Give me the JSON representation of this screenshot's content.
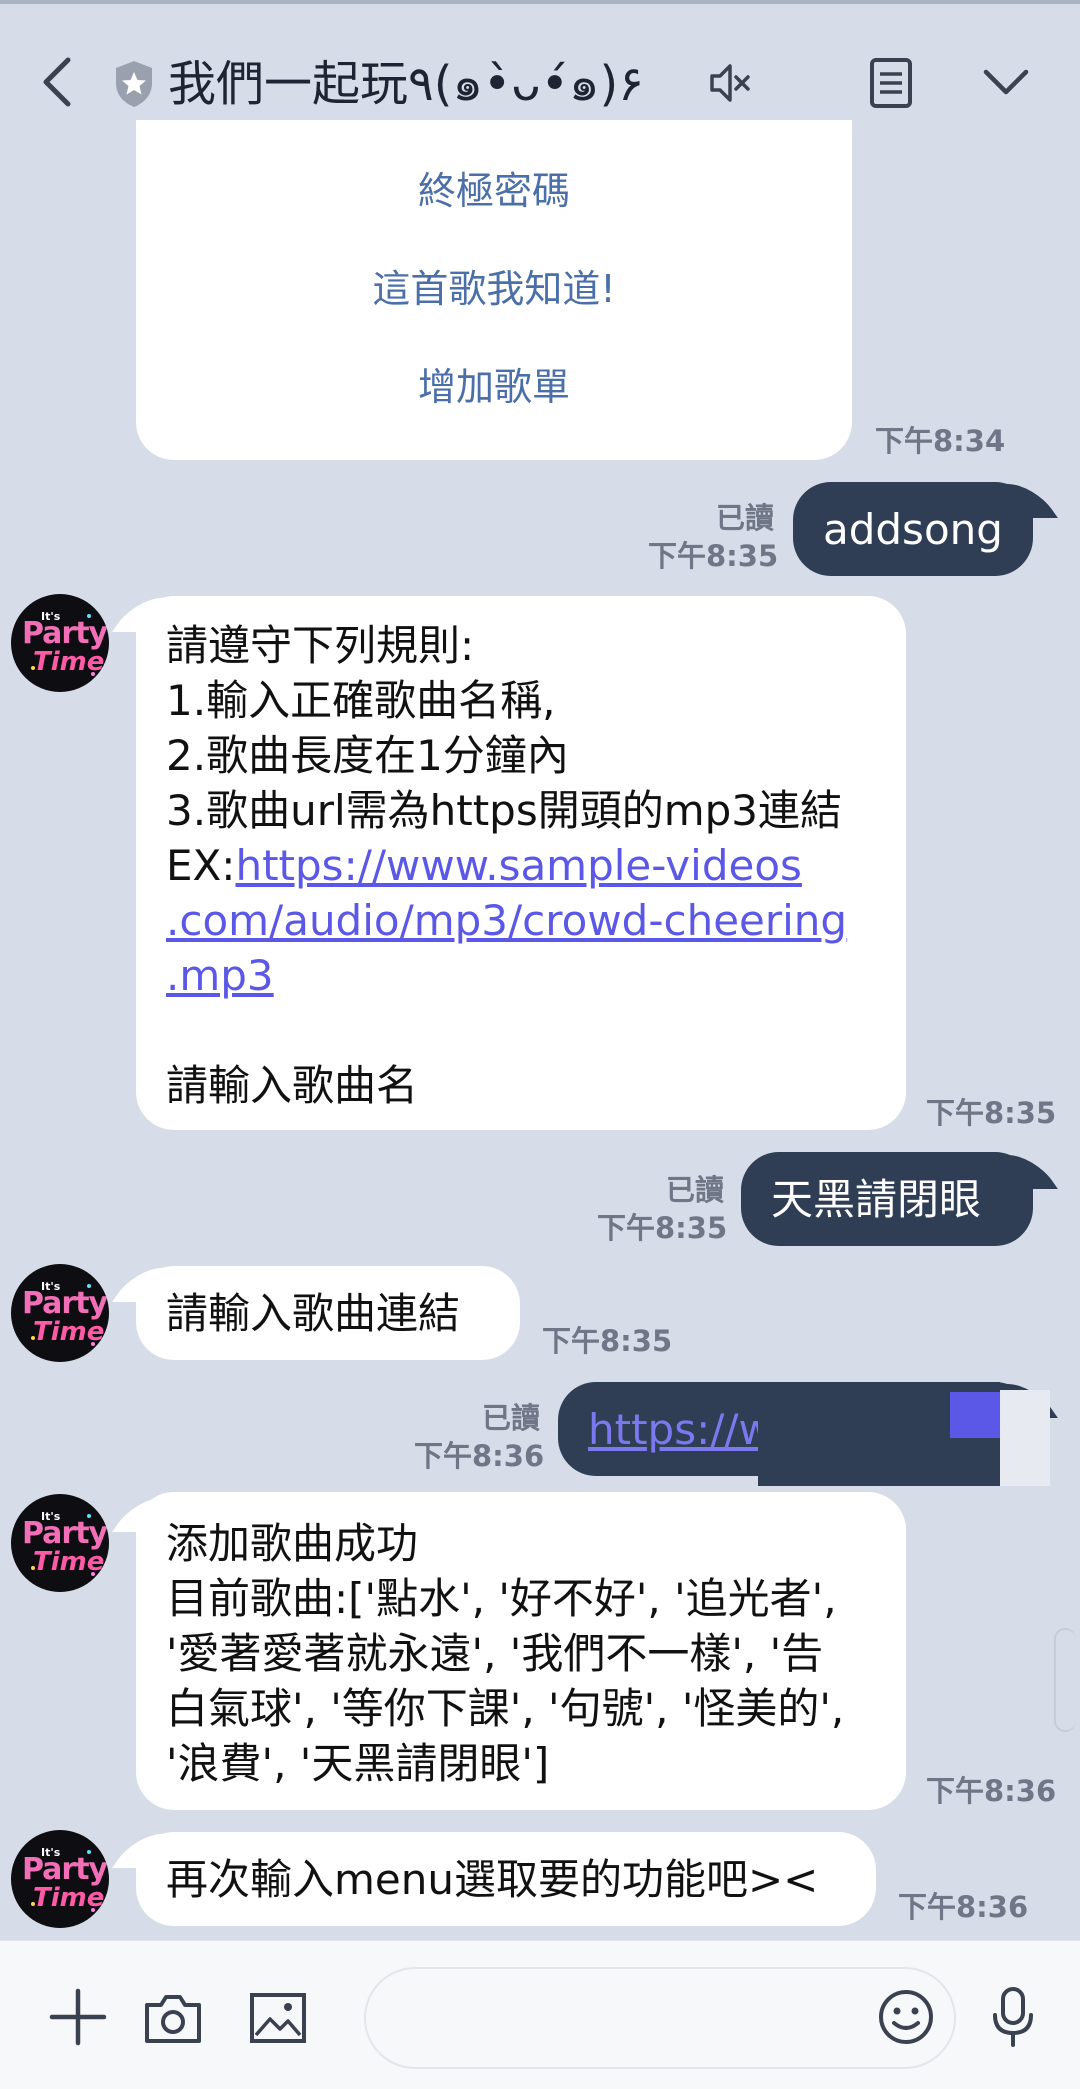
{
  "header": {
    "title": "我們一起玩٩(๑•̀ᴗ•́๑)۶"
  },
  "icons": {
    "back": "chevron-left-icon",
    "shield": "shield-icon",
    "mute": "mute-icon",
    "notes": "notes-icon",
    "dropdown": "chevron-down-icon",
    "add": "plus-icon",
    "camera": "camera-icon",
    "image": "image-icon",
    "emoji": "emoji-icon",
    "mic": "microphone-icon"
  },
  "colors": {
    "background": "#d7dde8",
    "my_bubble": "#2f3d55",
    "bot_bubble": "#ffffff",
    "menu_link": "#4b6fa8",
    "url_link": "#5b58e8"
  },
  "menu_card": {
    "items": [
      "終極密碼",
      "這首歌我知道!",
      "增加歌單"
    ],
    "time": "下午8:34"
  },
  "messages": [
    {
      "id": "m1",
      "side": "right",
      "text": "addsong",
      "read": "已讀",
      "time": "下午8:35"
    },
    {
      "id": "m2",
      "side": "left",
      "text_before": "請遵守下列規則:\n1.輸入正確歌曲名稱,\n2.歌曲長度在1分鐘內\n3.歌曲url需為https開頭的mp3連結\nEX:",
      "link": "https://www.sample-videos.com/audio/mp3/crowd-cheering.mp3",
      "link_lines": [
        "https://www.sample-videos",
        ".com/audio/mp3/crowd-cheering",
        ".mp3"
      ],
      "text_after": "請輸入歌曲名",
      "time": "下午8:35"
    },
    {
      "id": "m3",
      "side": "right",
      "text": "天黑請閉眼",
      "read": "已讀",
      "time": "下午8:35"
    },
    {
      "id": "m4",
      "side": "left",
      "text": "請輸入歌曲連結",
      "time": "下午8:35"
    },
    {
      "id": "m5",
      "side": "right",
      "text": "https://w",
      "read": "已讀",
      "time": "下午8:36"
    },
    {
      "id": "m6",
      "side": "left",
      "text": "添加歌曲成功\n目前歌曲:['點水', '好不好', '追光者',\n'愛著愛著就永遠', '我們不一樣', '告\n白氣球', '等你下課', '句號', '怪美的',\n'浪費', '天黑請閉眼']",
      "time": "下午8:36"
    },
    {
      "id": "m7",
      "side": "left",
      "text": "再次輸入menu選取要的功能吧><",
      "time": "下午8:36"
    }
  ],
  "avatar": {
    "line1": "It's",
    "line2": "Party",
    "line3": "Time!"
  },
  "composer": {
    "placeholder": ""
  }
}
